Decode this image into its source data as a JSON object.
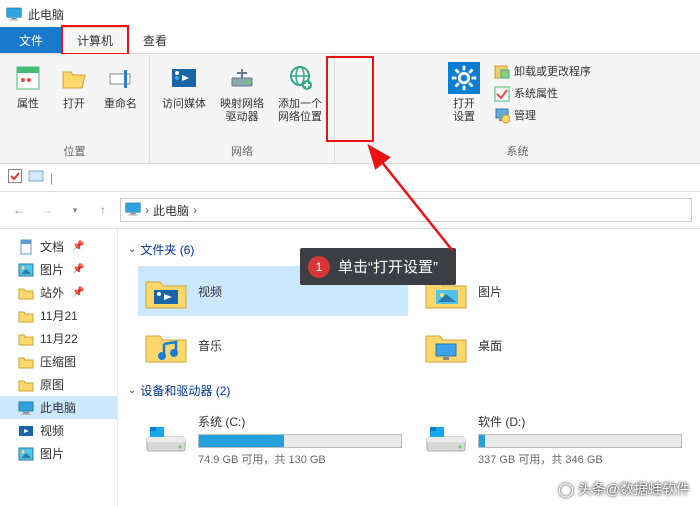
{
  "window": {
    "title": "此电脑"
  },
  "tabs": {
    "file": "文件",
    "computer": "计算机",
    "view": "查看"
  },
  "ribbon": {
    "group_location": "位置",
    "group_network": "网络",
    "group_system": "系统",
    "properties": "属性",
    "open": "打开",
    "rename": "重命名",
    "access_media": "访问媒体",
    "map_drive": "映射网络\n驱动器",
    "add_net_loc": "添加一个\n网络位置",
    "open_settings": "打开\n设置",
    "uninstall": "卸载或更改程序",
    "sys_props": "系统属性",
    "manage": "管理"
  },
  "breadcrumb": {
    "root": "此电脑",
    "sep": "›"
  },
  "sidebar": {
    "items": [
      {
        "label": "文档",
        "pinned": true,
        "icon": "doc"
      },
      {
        "label": "图片",
        "pinned": true,
        "icon": "pic"
      },
      {
        "label": "站外",
        "pinned": true,
        "icon": "folder"
      },
      {
        "label": "11月21",
        "pinned": false,
        "icon": "folder"
      },
      {
        "label": "11月22",
        "pinned": false,
        "icon": "folder"
      },
      {
        "label": "压缩图",
        "pinned": false,
        "icon": "folder"
      },
      {
        "label": "原图",
        "pinned": false,
        "icon": "folder"
      },
      {
        "label": "此电脑",
        "pinned": false,
        "icon": "pc",
        "selected": true
      },
      {
        "label": "视频",
        "pinned": false,
        "icon": "video"
      },
      {
        "label": "图片",
        "pinned": false,
        "icon": "pic"
      }
    ]
  },
  "content": {
    "folders_header": "文件夹 (6)",
    "drives_header": "设备和驱动器 (2)",
    "folders": [
      {
        "label": "视频",
        "icon": "video",
        "selected": true
      },
      {
        "label": "图片",
        "icon": "pic"
      },
      {
        "label": "音乐",
        "icon": "music"
      },
      {
        "label": "桌面",
        "icon": "desktop"
      }
    ],
    "drives": [
      {
        "name": "系统 (C:)",
        "free": "74.9 GB 可用，共 130 GB",
        "pct": 42
      },
      {
        "name": "软件 (D:)",
        "free": "337 GB 可用，共 346 GB",
        "pct": 3
      }
    ]
  },
  "callout": {
    "badge": "1",
    "text": "单击“打开设置”"
  },
  "watermark": "头条@数据蛙软件"
}
